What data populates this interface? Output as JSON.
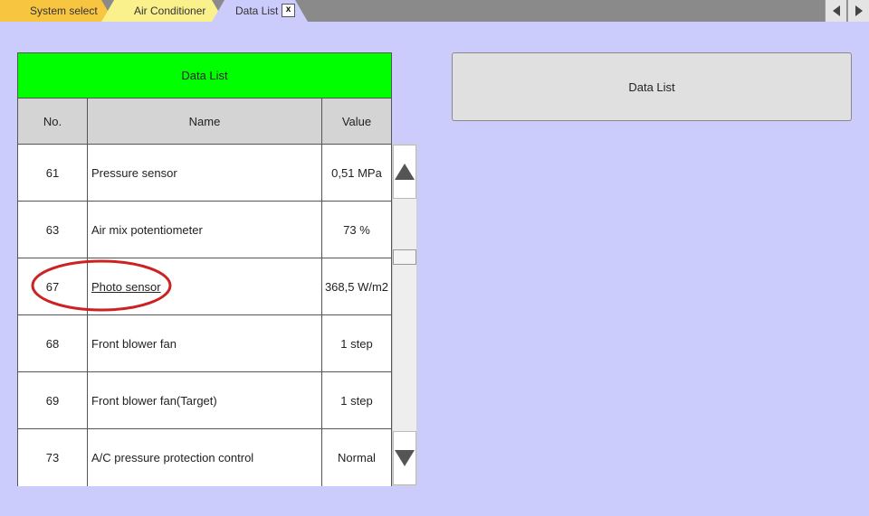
{
  "tabs": [
    {
      "label": "System select",
      "color": "#f7c540"
    },
    {
      "label": "Air Conditioner",
      "color": "#faf08c"
    },
    {
      "label": "Data List",
      "color": "#ccccfc",
      "close_label": "x"
    }
  ],
  "nav": {
    "prev_icon": "triangle-left-icon",
    "next_icon": "triangle-right-icon"
  },
  "table": {
    "title": "Data List",
    "title_color": "#00ff00",
    "columns": [
      "No.",
      "Name",
      "Value"
    ],
    "rows": [
      {
        "no": "61",
        "name": "Pressure sensor",
        "value": "0,51 MPa"
      },
      {
        "no": "63",
        "name": "Air mix potentiometer",
        "value": "73 %"
      },
      {
        "no": "67",
        "name": "Photo sensor",
        "value": "368,5 W/m2",
        "highlighted": true
      },
      {
        "no": "68",
        "name": "Front blower fan",
        "value": "1 step"
      },
      {
        "no": "69",
        "name": "Front blower fan(Target)",
        "value": "1 step"
      },
      {
        "no": "73",
        "name": "A/C pressure protection control",
        "value": "Normal"
      }
    ]
  },
  "scrollbar": {
    "up_icon": "triangle-up-icon",
    "down_icon": "triangle-down-icon"
  },
  "right_panel": {
    "label": "Data List"
  },
  "annotation": {
    "shape": "ellipse",
    "color": "#cc2222"
  }
}
